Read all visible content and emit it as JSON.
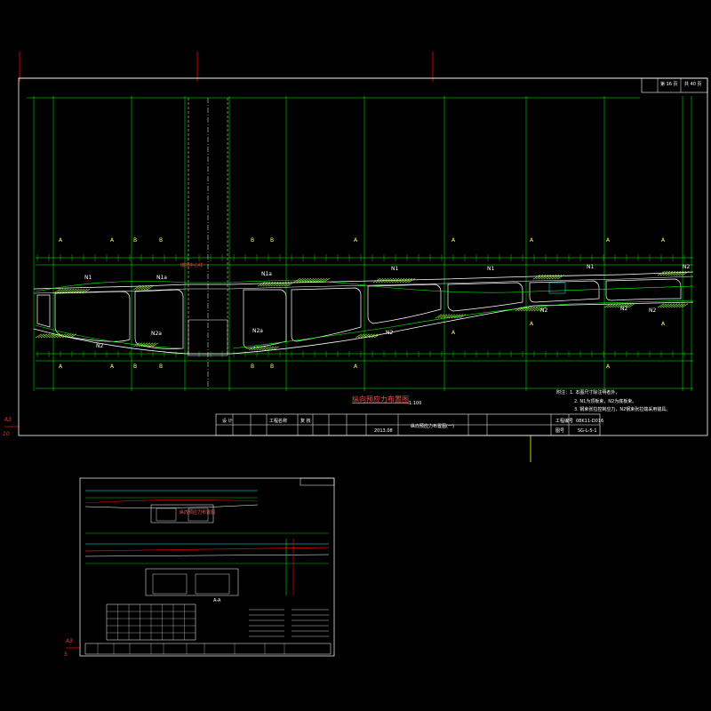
{
  "sheet_main": {
    "page_box": {
      "page": "第 16 页",
      "total": "共 40 页"
    },
    "section_labels_top": [
      "A",
      "A",
      "B",
      "B",
      "B",
      "B",
      "A",
      "A",
      "A",
      "A",
      "A"
    ],
    "section_labels_bottom": [
      "A",
      "A",
      "B",
      "B",
      "B",
      "B",
      "A",
      "A",
      "A",
      "A",
      "A"
    ],
    "tendon_labels": [
      "N1",
      "N1a",
      "N1a",
      "N1",
      "N1",
      "N1",
      "N2",
      "N2a",
      "N2a",
      "N2",
      "N2",
      "N2",
      "N2",
      "N2"
    ],
    "pier_label": "墩顶中心线",
    "title": "纵向预应力布置图",
    "scale": "1:100",
    "notes": [
      "附注：1. 本图尺寸除注明者外，",
      "2. N1为顶板束，N2为底板束。",
      "3. 钢束张拉控制应力，N2钢束张拉端采用锚具。"
    ],
    "title_block": {
      "design": "设 计",
      "check": "复 核",
      "project_label": "工程名称",
      "date_value": "2013.08",
      "drawing_name": "纵向预应力布置图(一)",
      "drawing_no_label": "图号",
      "drawing_no": "SG-L-5-1",
      "code_label": "工程编号",
      "code_value": "08K11-D016"
    }
  },
  "sheet_small": {
    "title": "纵向预应力布置图",
    "section": "A-A"
  },
  "marks": {
    "a1_top": "A3",
    "a1_bottom": "10",
    "a2_top": "A3",
    "a2_bottom": "5"
  },
  "colors": {
    "frame": "#ffffff",
    "green": "#00ff00",
    "cyan": "#00ffff",
    "red": "#ff0000",
    "yellow": "#ffff00",
    "hatch": "#9fff3f"
  }
}
